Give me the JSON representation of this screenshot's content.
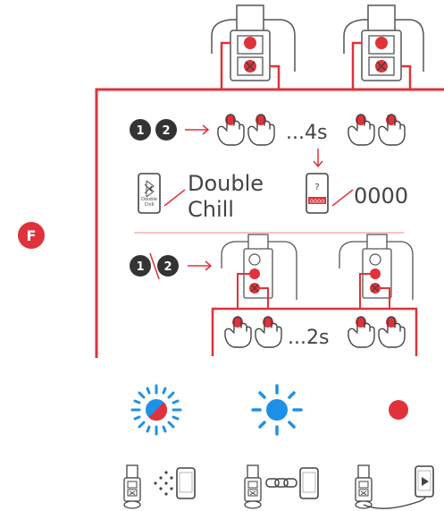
{
  "step_label": "F",
  "row1": {
    "badge_1": "1",
    "badge_2": "2",
    "hold_text": "...4s"
  },
  "row2": {
    "bt_phone_text": "Double\nChill",
    "bt_symbol": "bluetooth-icon",
    "app_name": "Double Chill",
    "app_name_line1": "Double",
    "app_name_line2": "Chill",
    "pin_phone_question": "?",
    "pin_phone_code": "0000",
    "pin_code": "0000"
  },
  "row3": {
    "badge_1": "1",
    "badge_2": "2",
    "hold_text": "...2s"
  },
  "status_icons": [
    "blue-red-blinking-light-icon",
    "blue-steady-light-icon",
    "red-steady-light-icon"
  ],
  "connection_icons": [
    "wireless-pairing-icon",
    "chain-link-connected-icon",
    "cable-connected-icon"
  ],
  "colors": {
    "accent_red": "#e0323a",
    "accent_blue": "#1e90e8",
    "dark": "#333333",
    "gray": "#555555"
  }
}
